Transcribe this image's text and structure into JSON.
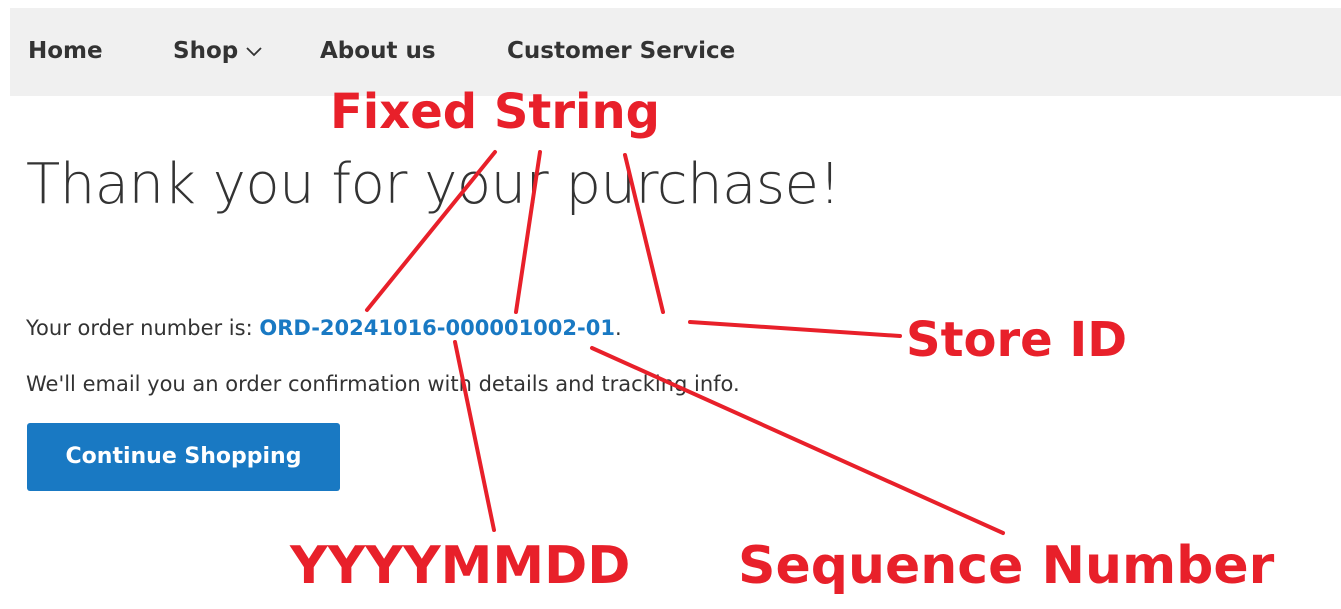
{
  "nav": {
    "items": [
      {
        "label": "Home"
      },
      {
        "label": "Shop"
      },
      {
        "label": "About us"
      },
      {
        "label": "Customer Service"
      }
    ]
  },
  "main": {
    "title": "Thank you for your purchase!",
    "order_prefix": "Your order number is: ",
    "order_number": "ORD-20241016-000001002-01",
    "order_suffix": ".",
    "confirmation": "We'll email you an order confirmation with details and tracking info.",
    "continue_label": "Continue Shopping"
  },
  "annotations": {
    "fixed_string": "Fixed String",
    "store_id": "Store ID",
    "date_format": "YYYYMMDD",
    "sequence_number": "Sequence Number"
  },
  "colors": {
    "accent": "#1979c3",
    "annotation": "#e8202a",
    "nav_background": "#f0f0f0",
    "text": "#333333"
  },
  "icons": {
    "shop_dropdown": "chevron-down-icon"
  }
}
